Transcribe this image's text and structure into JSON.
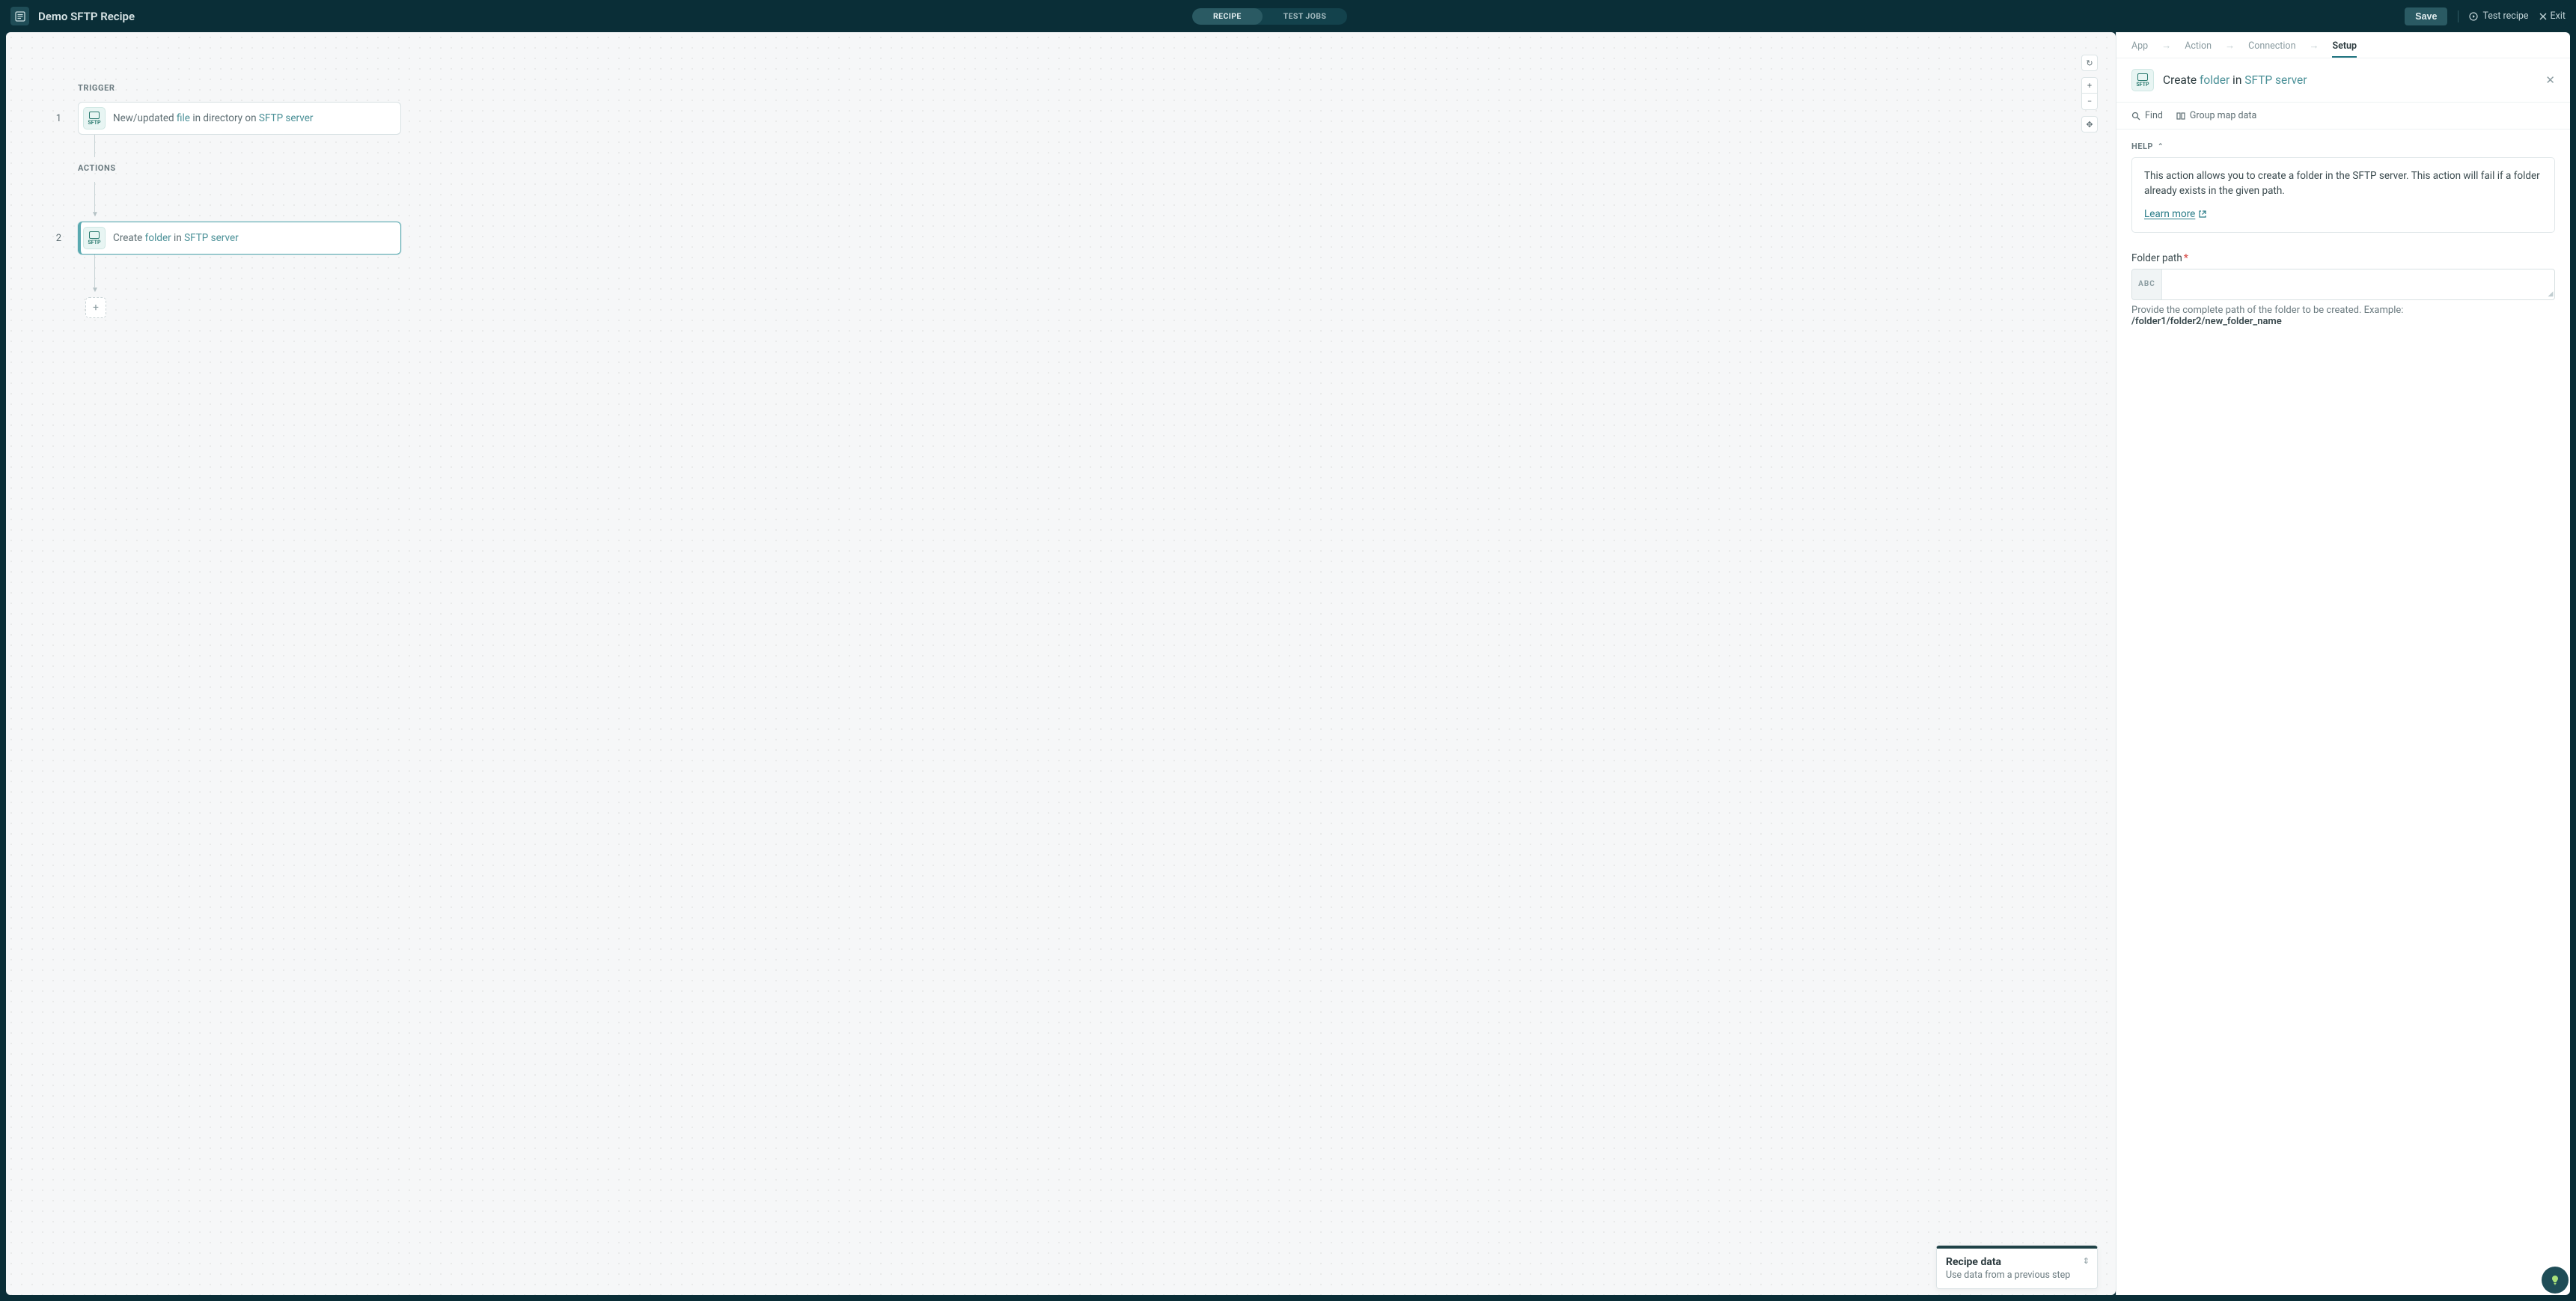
{
  "header": {
    "title": "Demo SFTP Recipe",
    "toggle": {
      "recipe": "RECIPE",
      "test_jobs": "TEST JOBS"
    },
    "save_label": "Save",
    "test_recipe_label": "Test recipe",
    "exit_label": "Exit"
  },
  "canvas": {
    "trigger_label": "TRIGGER",
    "actions_label": "ACTIONS",
    "steps": [
      {
        "num": "1",
        "pre": "New/updated ",
        "obj": "file",
        "mid": " in directory on ",
        "conn": "SFTP server"
      },
      {
        "num": "2",
        "pre": "Create ",
        "obj": "folder",
        "mid": " in ",
        "conn": "SFTP server"
      }
    ],
    "sftp_badge": "SFTP"
  },
  "zoom": {
    "reset": "↻",
    "in": "+",
    "out": "−",
    "fit": "✥"
  },
  "recipe_data": {
    "title": "Recipe data",
    "sub": "Use data from a previous step",
    "handle": "⇕"
  },
  "panel": {
    "crumbs": {
      "app": "App",
      "action": "Action",
      "connection": "Connection",
      "setup": "Setup"
    },
    "title_pre": "Create ",
    "title_obj": "folder",
    "title_mid": " in ",
    "title_conn": "SFTP server",
    "tools": {
      "find": "Find",
      "group": "Group map data"
    },
    "help_label": "HELP",
    "help_text": "This action allows you to create a folder in the SFTP server. This action will fail if a folder already exists in the given path.",
    "learn_more": "Learn more",
    "field": {
      "label": "Folder path",
      "type_badge": "ABC",
      "hint_pre": "Provide the complete path of the folder to be created. Example: ",
      "hint_bold": "/folder1/folder2/new_folder_name"
    }
  }
}
